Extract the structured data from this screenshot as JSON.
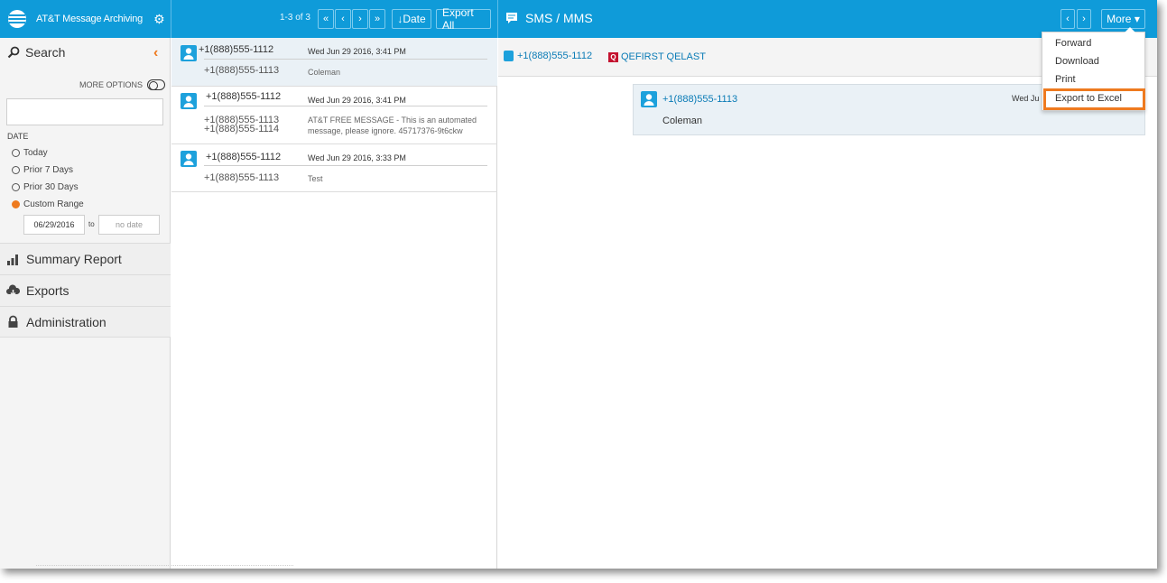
{
  "app": {
    "brand_name": "AT&T Message Archiving"
  },
  "toolbar": {
    "page_count": "1-3 of 3",
    "first_glyph": "«",
    "prev_glyph": "‹",
    "next_glyph": "›",
    "last_glyph": "»",
    "sort_label": "Date",
    "sort_glyph": "↓",
    "export_all_label": "Export All"
  },
  "detail_toolbar": {
    "title": "SMS / MMS",
    "prev_glyph": "‹",
    "next_glyph": "›",
    "more_label": "More",
    "more_glyph": "▾"
  },
  "sidebar": {
    "search_title": "Search",
    "collapse_glyph": "‹",
    "more_options_label": "MORE OPTIONS",
    "search_value": "",
    "date_label": "DATE",
    "date_options": [
      {
        "label": "Today",
        "selected": false
      },
      {
        "label": "Prior 7 Days",
        "selected": false
      },
      {
        "label": "Prior 30 Days",
        "selected": false
      },
      {
        "label": "Custom Range",
        "selected": true
      }
    ],
    "range_start": "06/29/2016",
    "range_to": "to",
    "range_end_placeholder": "no date",
    "nav": [
      {
        "label": "Summary Report",
        "icon": "bar-chart-icon"
      },
      {
        "label": "Exports",
        "icon": "cloud-download-icon"
      },
      {
        "label": "Administration",
        "icon": "lock-icon"
      }
    ]
  },
  "messages": [
    {
      "from": "+1(888)555-1112",
      "to": "+1(888)555-1113",
      "to2": "",
      "date": "Wed Jun 29 2016, 3:41 PM",
      "body": "Coleman",
      "selected": true
    },
    {
      "from": "+1(888)555-1112",
      "to": "+1(888)555-1113",
      "to2": "+1(888)555-1114",
      "date": "Wed Jun 29 2016, 3:41 PM",
      "body": "AT&T FREE MESSAGE - This is an automated message, please ignore. 45717376-9t6ckw",
      "selected": false
    },
    {
      "from": "+1(888)555-1112",
      "to": "+1(888)555-1113",
      "to2": "",
      "date": "Wed Jun 29 2016, 3:33 PM",
      "body": "Test",
      "selected": false
    }
  ],
  "detail": {
    "header_from": "+1(888)555-1112",
    "header_to": "QEFIRST QELAST",
    "header_to_badge": "Q",
    "bubble_from": "+1(888)555-1113",
    "bubble_date": "Wed Ju",
    "bubble_text": "Coleman"
  },
  "more_menu": {
    "items": [
      "Forward",
      "Download",
      "Print",
      "Export to Excel"
    ],
    "highlighted": "Export to Excel"
  },
  "colors": {
    "brand_blue": "#0f9bd9",
    "accent_orange": "#ee7a1f",
    "link_blue": "#0a7bb6"
  }
}
